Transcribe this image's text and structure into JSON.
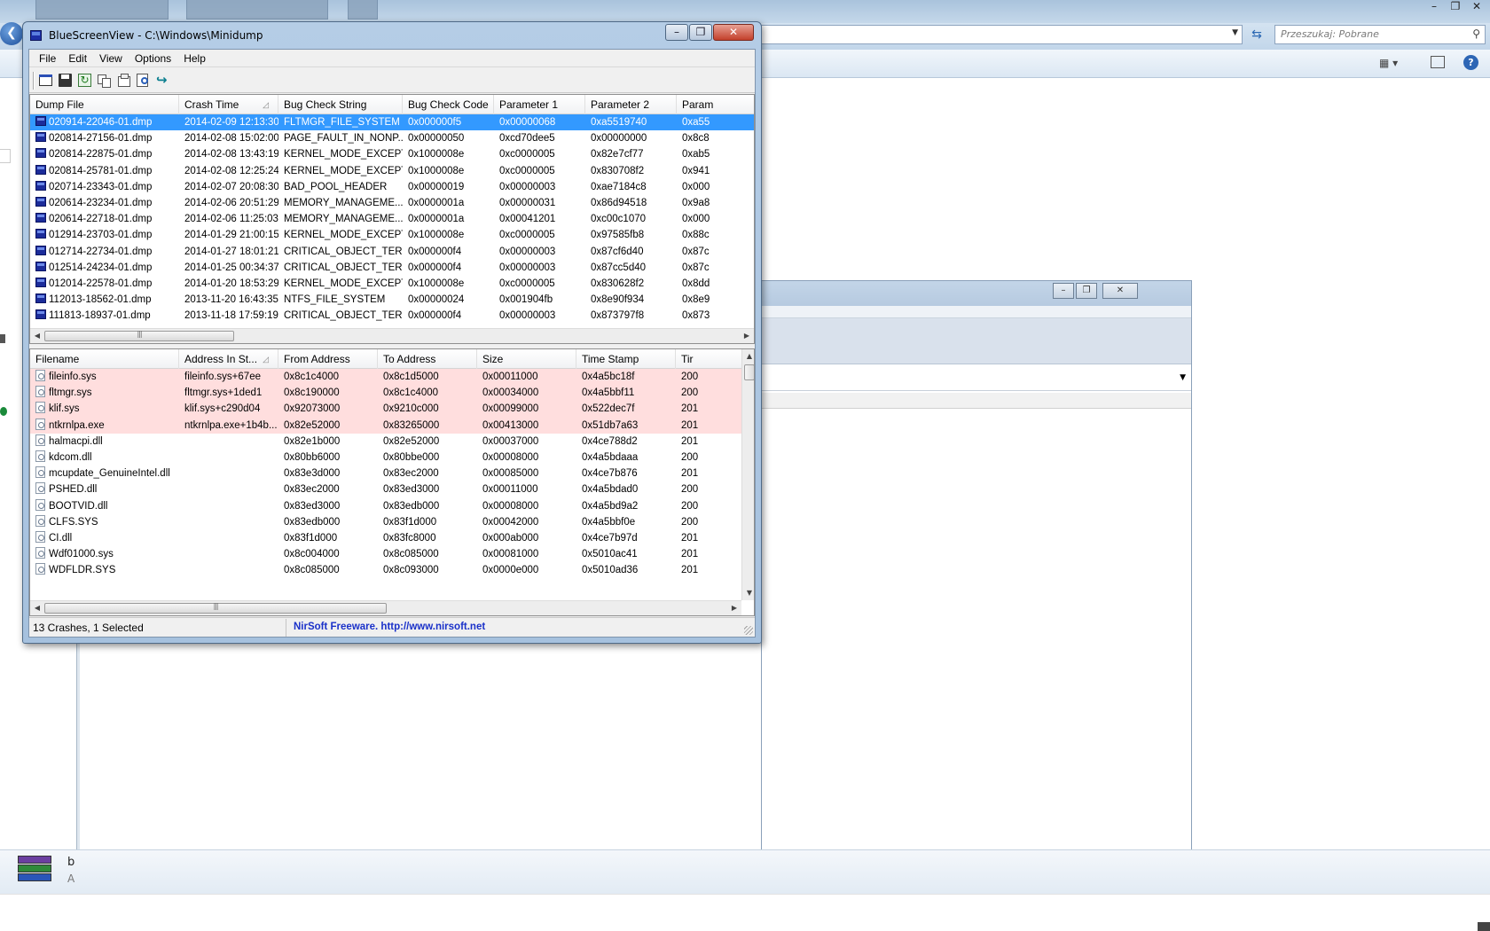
{
  "background": {
    "search_placeholder": "Przeszukaj: Pobrane",
    "status_item": {
      "title": "b",
      "subtitle": "A"
    }
  },
  "window": {
    "title": "BlueScreenView  -  C:\\Windows\\Minidump",
    "menu": [
      "File",
      "Edit",
      "View",
      "Options",
      "Help"
    ],
    "toolbar_icons": [
      "properties-icon",
      "save-icon",
      "refresh-icon",
      "copy-icon",
      "html-report-icon",
      "find-icon",
      "exit-icon"
    ]
  },
  "crashes": {
    "columns": [
      "Dump File",
      "Crash Time",
      "Bug Check String",
      "Bug Check Code",
      "Parameter 1",
      "Parameter 2",
      "Param"
    ],
    "sorted_column": 1,
    "selected_row": 0,
    "rows": [
      [
        "020914-22046-01.dmp",
        "2014-02-09 12:13:30",
        "FLTMGR_FILE_SYSTEM",
        "0x000000f5",
        "0x00000068",
        "0xa5519740",
        "0xa55"
      ],
      [
        "020814-27156-01.dmp",
        "2014-02-08 15:02:00",
        "PAGE_FAULT_IN_NONP...",
        "0x00000050",
        "0xcd70dee5",
        "0x00000000",
        "0x8c8"
      ],
      [
        "020814-22875-01.dmp",
        "2014-02-08 13:43:19",
        "KERNEL_MODE_EXCEPTI...",
        "0x1000008e",
        "0xc0000005",
        "0x82e7cf77",
        "0xab5"
      ],
      [
        "020814-25781-01.dmp",
        "2014-02-08 12:25:24",
        "KERNEL_MODE_EXCEPTI...",
        "0x1000008e",
        "0xc0000005",
        "0x830708f2",
        "0x941"
      ],
      [
        "020714-23343-01.dmp",
        "2014-02-07 20:08:30",
        "BAD_POOL_HEADER",
        "0x00000019",
        "0x00000003",
        "0xae7184c8",
        "0x000"
      ],
      [
        "020614-23234-01.dmp",
        "2014-02-06 20:51:29",
        "MEMORY_MANAGEME...",
        "0x0000001a",
        "0x00000031",
        "0x86d94518",
        "0x9a8"
      ],
      [
        "020614-22718-01.dmp",
        "2014-02-06 11:25:03",
        "MEMORY_MANAGEME...",
        "0x0000001a",
        "0x00041201",
        "0xc00c1070",
        "0x000"
      ],
      [
        "012914-23703-01.dmp",
        "2014-01-29 21:00:15",
        "KERNEL_MODE_EXCEPTI...",
        "0x1000008e",
        "0xc0000005",
        "0x97585fb8",
        "0x88c"
      ],
      [
        "012714-22734-01.dmp",
        "2014-01-27 18:01:21",
        "CRITICAL_OBJECT_TER...",
        "0x000000f4",
        "0x00000003",
        "0x87cf6d40",
        "0x87c"
      ],
      [
        "012514-24234-01.dmp",
        "2014-01-25 00:34:37",
        "CRITICAL_OBJECT_TER...",
        "0x000000f4",
        "0x00000003",
        "0x87cc5d40",
        "0x87c"
      ],
      [
        "012014-22578-01.dmp",
        "2014-01-20 18:53:29",
        "KERNEL_MODE_EXCEPTI...",
        "0x1000008e",
        "0xc0000005",
        "0x830628f2",
        "0x8dd"
      ],
      [
        "112013-18562-01.dmp",
        "2013-11-20 16:43:35",
        "NTFS_FILE_SYSTEM",
        "0x00000024",
        "0x001904fb",
        "0x8e90f934",
        "0x8e9"
      ],
      [
        "111813-18937-01.dmp",
        "2013-11-18 17:59:19",
        "CRITICAL_OBJECT_TER...",
        "0x000000f4",
        "0x00000003",
        "0x873797f8",
        "0x873"
      ]
    ]
  },
  "drivers": {
    "columns": [
      "Filename",
      "Address In St...",
      "From Address",
      "To Address",
      "Size",
      "Time Stamp",
      "Tir"
    ],
    "sorted_column": 1,
    "highlighted_rows": [
      0,
      1,
      2,
      3
    ],
    "rows": [
      [
        "fileinfo.sys",
        "fileinfo.sys+67ee",
        "0x8c1c4000",
        "0x8c1d5000",
        "0x00011000",
        "0x4a5bc18f",
        "200"
      ],
      [
        "fltmgr.sys",
        "fltmgr.sys+1ded1",
        "0x8c190000",
        "0x8c1c4000",
        "0x00034000",
        "0x4a5bbf11",
        "200"
      ],
      [
        "klif.sys",
        "klif.sys+c290d04",
        "0x92073000",
        "0x9210c000",
        "0x00099000",
        "0x522dec7f",
        "201"
      ],
      [
        "ntkrnlpa.exe",
        "ntkrnlpa.exe+1b4b...",
        "0x82e52000",
        "0x83265000",
        "0x00413000",
        "0x51db7a63",
        "201"
      ],
      [
        "halmacpi.dll",
        "",
        "0x82e1b000",
        "0x82e52000",
        "0x00037000",
        "0x4ce788d2",
        "201"
      ],
      [
        "kdcom.dll",
        "",
        "0x80bb6000",
        "0x80bbe000",
        "0x00008000",
        "0x4a5bdaaa",
        "200"
      ],
      [
        "mcupdate_GenuineIntel.dll",
        "",
        "0x83e3d000",
        "0x83ec2000",
        "0x00085000",
        "0x4ce7b876",
        "201"
      ],
      [
        "PSHED.dll",
        "",
        "0x83ec2000",
        "0x83ed3000",
        "0x00011000",
        "0x4a5bdad0",
        "200"
      ],
      [
        "BOOTVID.dll",
        "",
        "0x83ed3000",
        "0x83edb000",
        "0x00008000",
        "0x4a5bd9a2",
        "200"
      ],
      [
        "CLFS.SYS",
        "",
        "0x83edb000",
        "0x83f1d000",
        "0x00042000",
        "0x4a5bbf0e",
        "200"
      ],
      [
        "CI.dll",
        "",
        "0x83f1d000",
        "0x83fc8000",
        "0x000ab000",
        "0x4ce7b97d",
        "201"
      ],
      [
        "Wdf01000.sys",
        "",
        "0x8c004000",
        "0x8c085000",
        "0x00081000",
        "0x5010ac41",
        "201"
      ],
      [
        "WDFLDR.SYS",
        "",
        "0x8c085000",
        "0x8c093000",
        "0x0000e000",
        "0x5010ad36",
        "201"
      ]
    ]
  },
  "status": {
    "summary": "13 Crashes, 1 Selected",
    "credit": "NirSoft Freeware.  http://www.nirsoft.net"
  }
}
